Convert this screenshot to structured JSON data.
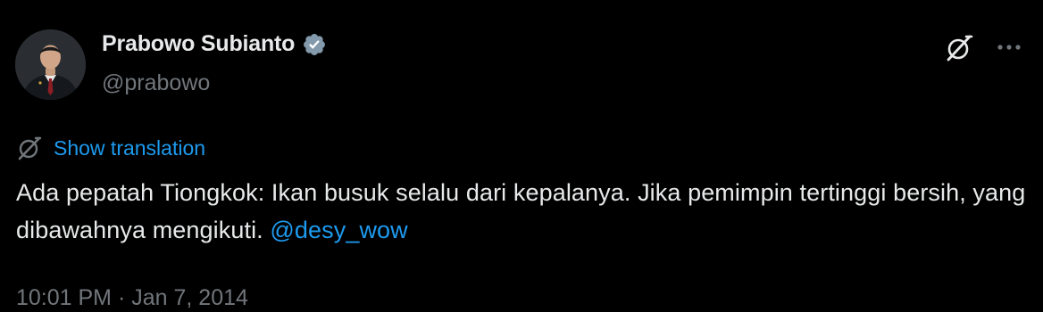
{
  "author": {
    "display_name": "Prabowo Subianto",
    "handle": "@prabowo",
    "verified": true,
    "verified_color": "#829aab"
  },
  "translation": {
    "label": "Show translation",
    "icon": "translate-icon"
  },
  "tweet": {
    "text_main": "Ada pepatah Tiongkok: Ikan busuk selalu dari kepalanya. Jika pemimpin tertinggi bersih, yang dibawahnya mengikuti.",
    "mention": "@desy_wow"
  },
  "meta": {
    "time": "10:01 PM",
    "separator": "·",
    "date": "Jan 7, 2014"
  },
  "icons": {
    "grok": "grok-icon",
    "more": "more-icon"
  },
  "colors": {
    "background": "#000000",
    "text": "#e7e9ea",
    "secondary": "#71767b",
    "link": "#1d9bf0"
  }
}
